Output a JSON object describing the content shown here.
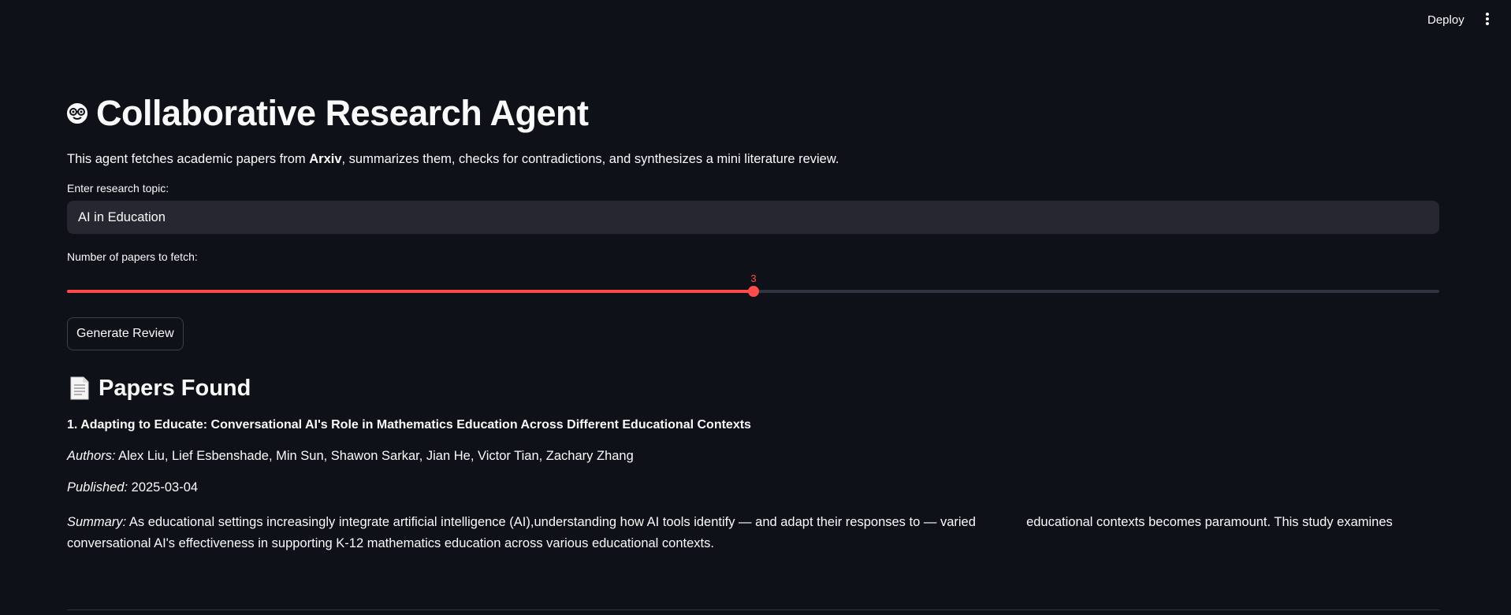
{
  "header": {
    "deploy_label": "Deploy"
  },
  "page": {
    "title": "Collaborative Research Agent",
    "description_pre": "This agent fetches academic papers from ",
    "description_bold": "Arxiv",
    "description_post": ", summarizes them, checks for contradictions, and synthesizes a mini literature review."
  },
  "topic_input": {
    "label": "Enter research topic:",
    "value": "AI in Education"
  },
  "papers_slider": {
    "label": "Number of papers to fetch:",
    "value": "3",
    "min": 1,
    "max": 5,
    "fill_fraction": 0.5
  },
  "generate_button": {
    "label": "Generate Review"
  },
  "papers_section": {
    "heading": "Papers Found",
    "papers": [
      {
        "title": "1. Adapting to Educate: Conversational AI's Role in Mathematics Education Across Different Educational Contexts",
        "authors_label": "Authors:",
        "authors": "Alex Liu, Lief Esbenshade, Min Sun, Shawon Sarkar, Jian He, Victor Tian, Zachary Zhang",
        "published_label": "Published:",
        "published": "2025-03-04",
        "summary_label": "Summary:",
        "summary": "As educational settings increasingly integrate artificial intelligence (AI),understanding how AI tools identify — and adapt their responses to — varied              educational contexts becomes paramount. This study examines conversational AI's effectiveness in supporting K-12 mathematics education across various educational contexts."
      }
    ]
  },
  "colors": {
    "background": "#0e1117",
    "accent": "#ff4b4b",
    "input_bg": "#262730"
  }
}
